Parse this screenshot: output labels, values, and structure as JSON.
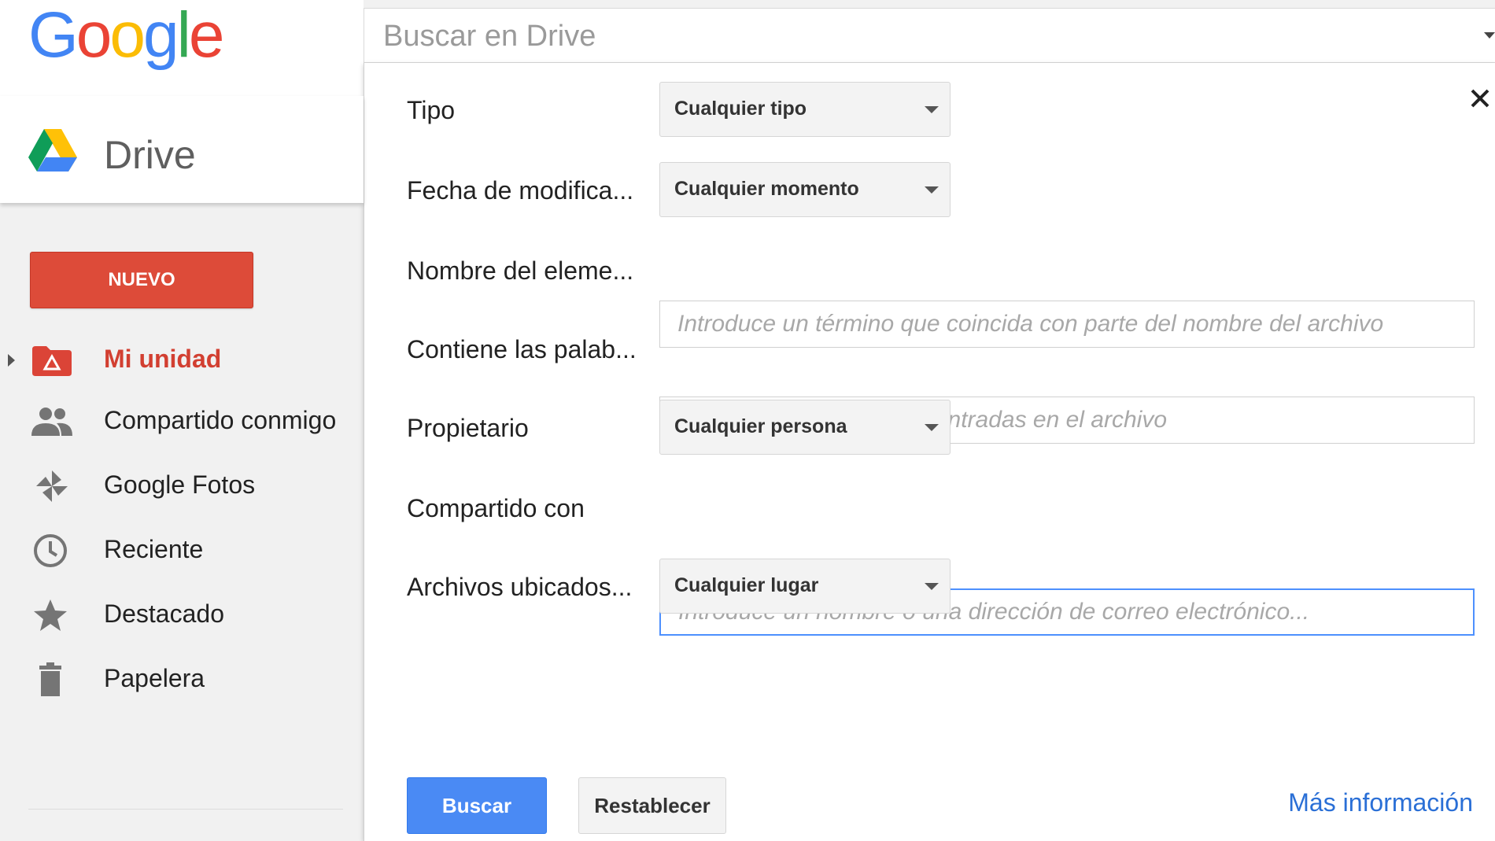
{
  "brand": {
    "logo_letters": [
      "G",
      "o",
      "o",
      "g",
      "l",
      "e"
    ],
    "logo_colors": [
      "#4285F4",
      "#EA4335",
      "#FBBC05",
      "#4285F4",
      "#34A853",
      "#EA4335"
    ],
    "app_name": "Drive"
  },
  "search": {
    "placeholder": "Buscar en Drive"
  },
  "sidebar": {
    "new_button": "NUEVO",
    "items": [
      {
        "label": "Mi unidad",
        "icon": "my-drive-folder-icon",
        "active": true
      },
      {
        "label": "Compartido conmigo",
        "icon": "people-icon"
      },
      {
        "label": "Google Fotos",
        "icon": "pinwheel-icon"
      },
      {
        "label": "Reciente",
        "icon": "clock-icon"
      },
      {
        "label": "Destacado",
        "icon": "star-icon"
      },
      {
        "label": "Papelera",
        "icon": "trash-icon"
      }
    ]
  },
  "advanced_search": {
    "type_label": "Tipo",
    "type_value": "Cualquier tipo",
    "modified_label": "Fecha de modifica...",
    "modified_value": "Cualquier momento",
    "item_name_label": "Nombre del eleme...",
    "item_name_placeholder": "Introduce un término que coincida con parte del nombre del archivo",
    "contains_label": "Contiene las palab...",
    "contains_placeholder": "Escribe las palabras encontradas en el archivo",
    "owner_label": "Propietario",
    "owner_value": "Cualquier persona",
    "shared_with_label": "Compartido con",
    "shared_with_placeholder": "Introduce un nombre o una dirección de correo electrónico...",
    "location_label": "Archivos ubicados...",
    "location_value": "Cualquier lugar",
    "search_button": "Buscar",
    "reset_button": "Restablecer",
    "more_info_link": "Más información"
  },
  "colors": {
    "accent_red": "#dd4b39",
    "accent_blue": "#4a8af4",
    "link_blue": "#2a6fd6"
  }
}
